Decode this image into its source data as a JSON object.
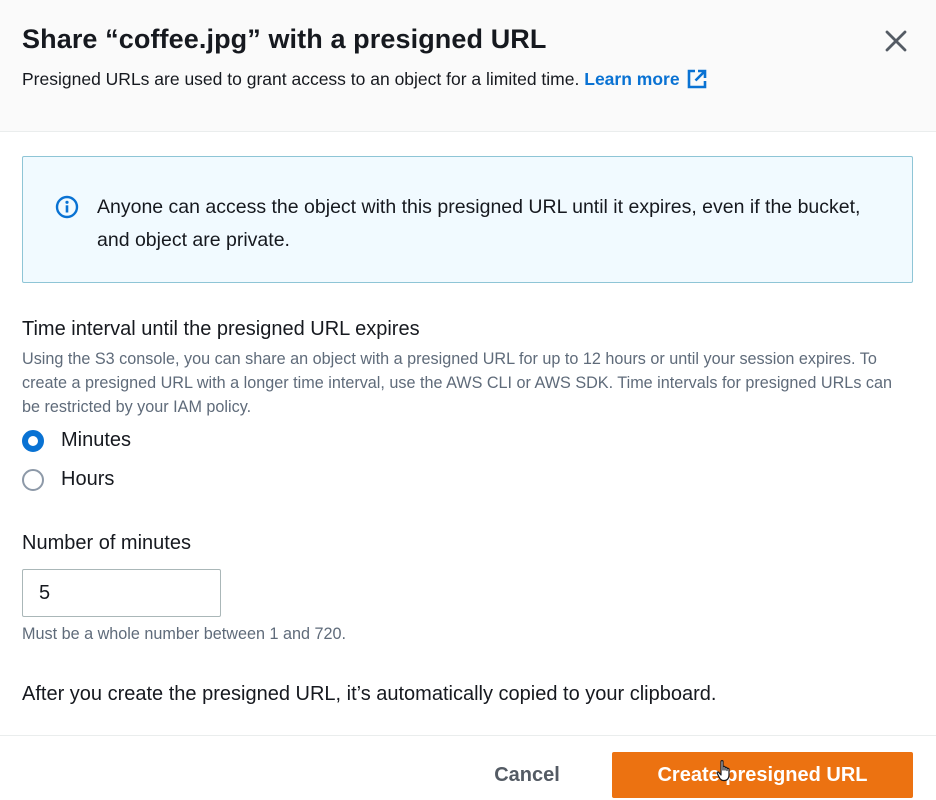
{
  "modal": {
    "title": "Share “coffee.jpg” with a presigned URL",
    "subtitle": "Presigned URLs are used to grant access to an object for a limited time.",
    "learn_more": "Learn more",
    "close_icon": "close-icon",
    "external_link_icon": "external-link-icon"
  },
  "info_alert": {
    "icon": "info-icon",
    "text": "Anyone can access the object with this presigned URL until it expires, even if the bucket, and object are private."
  },
  "expiry": {
    "label": "Time interval until the presigned URL expires",
    "description": "Using the S3 console, you can share an object with a presigned URL for up to 12 hours or until your session expires. To create a presigned URL with a longer time interval, use the AWS CLI or AWS SDK. Time intervals for presigned URLs can be restricted by your IAM policy.",
    "options": [
      {
        "label": "Minutes",
        "selected": true
      },
      {
        "label": "Hours",
        "selected": false
      }
    ]
  },
  "minutes_field": {
    "label": "Number of minutes",
    "value": "5",
    "constraint": "Must be a whole number between 1 and 720."
  },
  "after_note": "After you create the presigned URL, it’s automatically copied to your clipboard.",
  "footer": {
    "cancel_label": "Cancel",
    "primary_label": "Create presigned URL"
  },
  "colors": {
    "primary": "#ec7211",
    "link": "#0972d3",
    "info_background": "#f1faff",
    "info_border": "#8ec5d6",
    "text": "#16191f",
    "secondary_text": "#5f6b7a"
  }
}
